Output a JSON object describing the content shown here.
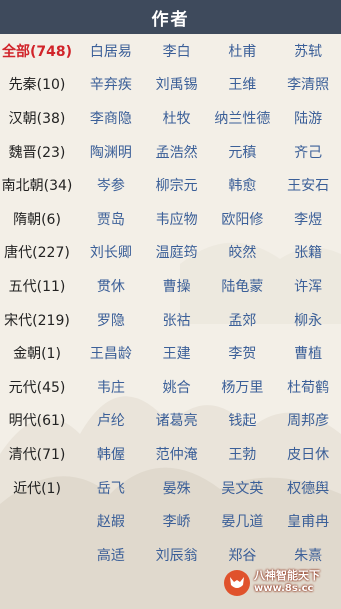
{
  "header": {
    "title": "作者"
  },
  "dynasties": [
    "全部(748)",
    "先秦(10)",
    "汉朝(38)",
    "魏晋(23)",
    "南北朝(34)",
    "隋朝(6)",
    "唐代(227)",
    "五代(11)",
    "宋代(219)",
    "金朝(1)",
    "元代(45)",
    "明代(61)",
    "清代(71)",
    "近代(1)"
  ],
  "authors": [
    "白居易",
    "李白",
    "杜甫",
    "苏轼",
    "辛弃疾",
    "刘禹锡",
    "王维",
    "李清照",
    "李商隐",
    "杜牧",
    "纳兰性德",
    "陆游",
    "陶渊明",
    "孟浩然",
    "元稹",
    "齐己",
    "岑参",
    "柳宗元",
    "韩愈",
    "王安石",
    "贾岛",
    "韦应物",
    "欧阳修",
    "李煜",
    "刘长卿",
    "温庭筠",
    "皎然",
    "张籍",
    "贯休",
    "曹操",
    "陆龟蒙",
    "许浑",
    "罗隐",
    "张祜",
    "孟郊",
    "柳永",
    "王昌龄",
    "王建",
    "李贺",
    "曹植",
    "韦庄",
    "姚合",
    "杨万里",
    "杜荀鹤",
    "卢纶",
    "诸葛亮",
    "钱起",
    "周邦彦",
    "韩偓",
    "范仲淹",
    "王勃",
    "皮日休",
    "岳飞",
    "晏殊",
    "吴文英",
    "权德舆",
    "赵嘏",
    "李峤",
    "晏几道",
    "皇甫冉",
    "高适",
    "刘辰翁",
    "郑谷",
    "朱熹"
  ],
  "watermark": {
    "line1": "八神智能天下",
    "line2": "www.8s.cc",
    "icon": "fox-logo-icon",
    "color": "#e0522c"
  },
  "colors": {
    "header_bg": "#3e4a5c",
    "active": "#d1242a",
    "author": "#3b5f98",
    "background": "#f3efe7"
  }
}
